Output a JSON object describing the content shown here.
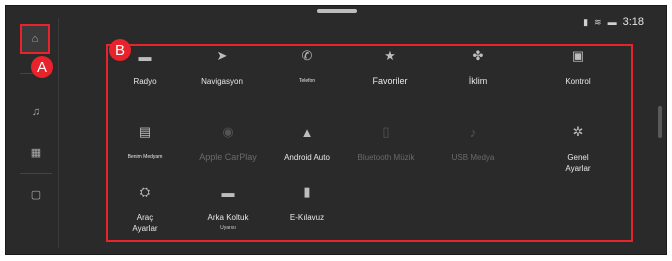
{
  "markers": {
    "a": "A",
    "b": "B"
  },
  "status": {
    "time": "3:18",
    "icons": [
      "signal-icon",
      "wifi-icon",
      "battery-icon"
    ]
  },
  "sidebar": {
    "items": [
      "home-icon",
      "music-icon",
      "apps-icon",
      "settings-icon"
    ]
  },
  "tiles": [
    {
      "label": "Radyo",
      "icon": "radio-icon"
    },
    {
      "label": "Navigasyon",
      "icon": "navigation-icon"
    },
    {
      "label": "Telefon",
      "icon": "phone-icon"
    },
    {
      "label": "Favoriler",
      "icon": "star-icon"
    },
    {
      "label": "İklim",
      "icon": "fan-icon"
    },
    {
      "label": "Kontrol",
      "icon": "control-icon"
    },
    {
      "label": "Benim Medyam",
      "icon": "media-icon"
    },
    {
      "label": "Apple CarPlay",
      "icon": "carplay-icon"
    },
    {
      "label": "Android Auto",
      "icon": "android-auto-icon"
    },
    {
      "label": "Bluetooth Müzik",
      "icon": "bluetooth-music-icon"
    },
    {
      "label": "USB Medya",
      "icon": "usb-icon"
    },
    {
      "label": "Genel Ayarlar",
      "icon": "gear-icon"
    },
    {
      "label": "Araç Ayarlar",
      "icon": "car-settings-icon"
    },
    {
      "label": "Arka Koltuk",
      "sub": "Uyarısı",
      "icon": "rear-seat-icon"
    },
    {
      "label": "E-Kılavuz",
      "icon": "manual-icon"
    }
  ]
}
